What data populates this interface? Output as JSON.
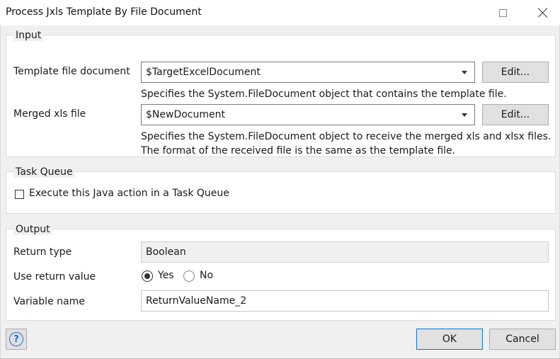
{
  "window": {
    "title": "Process Jxls Template By File Document"
  },
  "input": {
    "legend": "Input",
    "template_label": "Template file document",
    "template_value": "$TargetExcelDocument",
    "template_edit": "Edit...",
    "template_desc": "Specifies the System.FileDocument object that contains the template file.",
    "merged_label": "Merged xls file",
    "merged_value": "$NewDocument",
    "merged_edit": "Edit...",
    "merged_desc_1": "Specifies the System.FileDocument object to receive the merged xls and xlsx files.",
    "merged_desc_2": "The format of the received file is the same as the template file."
  },
  "task_queue": {
    "legend": "Task Queue",
    "checkbox_label": "Execute this Java action in a Task Queue",
    "checked": false
  },
  "output": {
    "legend": "Output",
    "return_type_label": "Return type",
    "return_type_value": "Boolean",
    "use_return_label": "Use return value",
    "yes_label": "Yes",
    "no_label": "No",
    "selected": "Yes",
    "variable_label": "Variable name",
    "variable_value": "ReturnValueName_2"
  },
  "footer": {
    "help_glyph": "?",
    "ok_label": "OK",
    "cancel_label": "Cancel"
  }
}
